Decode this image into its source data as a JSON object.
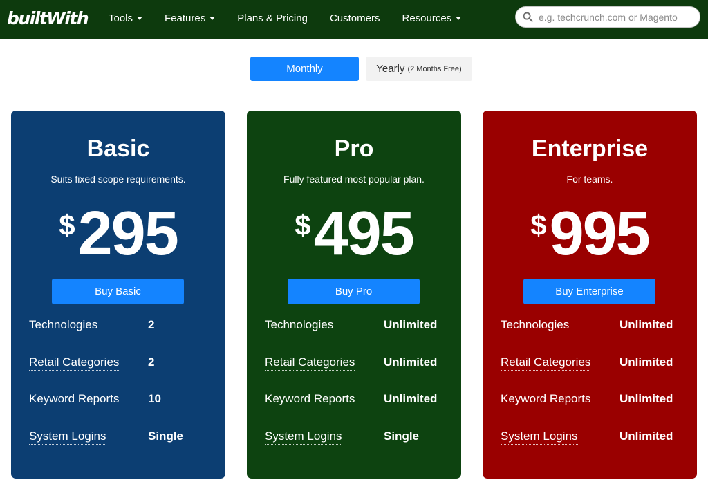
{
  "nav": {
    "logo_text": "builtWith",
    "items": [
      {
        "label": "Tools",
        "dropdown": true
      },
      {
        "label": "Features",
        "dropdown": true
      },
      {
        "label": "Plans & Pricing",
        "dropdown": false
      },
      {
        "label": "Customers",
        "dropdown": false
      },
      {
        "label": "Resources",
        "dropdown": true
      }
    ],
    "search_placeholder": "e.g. techcrunch.com or Magento",
    "search_value": ""
  },
  "billing_toggle": {
    "monthly_label": "Monthly",
    "yearly_label": "Yearly",
    "yearly_note": "(2 Months Free)",
    "selected": "monthly"
  },
  "colors": {
    "nav_bg": "#0d3a0d",
    "accent_blue": "#1484ff",
    "basic_card": "#0c3e72",
    "pro_card": "#0d4310",
    "enterprise_card": "#9a0000"
  },
  "plans": [
    {
      "name": "Basic",
      "description": "Suits fixed scope requirements.",
      "currency": "$",
      "price": "295",
      "buy_label": "Buy Basic",
      "features": [
        {
          "label": "Technologies",
          "value": "2"
        },
        {
          "label": "Retail Categories",
          "value": "2"
        },
        {
          "label": "Keyword Reports",
          "value": "10"
        },
        {
          "label": "System Logins",
          "value": "Single"
        }
      ]
    },
    {
      "name": "Pro",
      "description": "Fully featured most popular plan.",
      "currency": "$",
      "price": "495",
      "buy_label": "Buy Pro",
      "features": [
        {
          "label": "Technologies",
          "value": "Unlimited"
        },
        {
          "label": "Retail Categories",
          "value": "Unlimited"
        },
        {
          "label": "Keyword Reports",
          "value": "Unlimited"
        },
        {
          "label": "System Logins",
          "value": "Single"
        }
      ]
    },
    {
      "name": "Enterprise",
      "description": "For teams.",
      "currency": "$",
      "price": "995",
      "buy_label": "Buy Enterprise",
      "features": [
        {
          "label": "Technologies",
          "value": "Unlimited"
        },
        {
          "label": "Retail Categories",
          "value": "Unlimited"
        },
        {
          "label": "Keyword Reports",
          "value": "Unlimited"
        },
        {
          "label": "System Logins",
          "value": "Unlimited"
        }
      ]
    }
  ]
}
